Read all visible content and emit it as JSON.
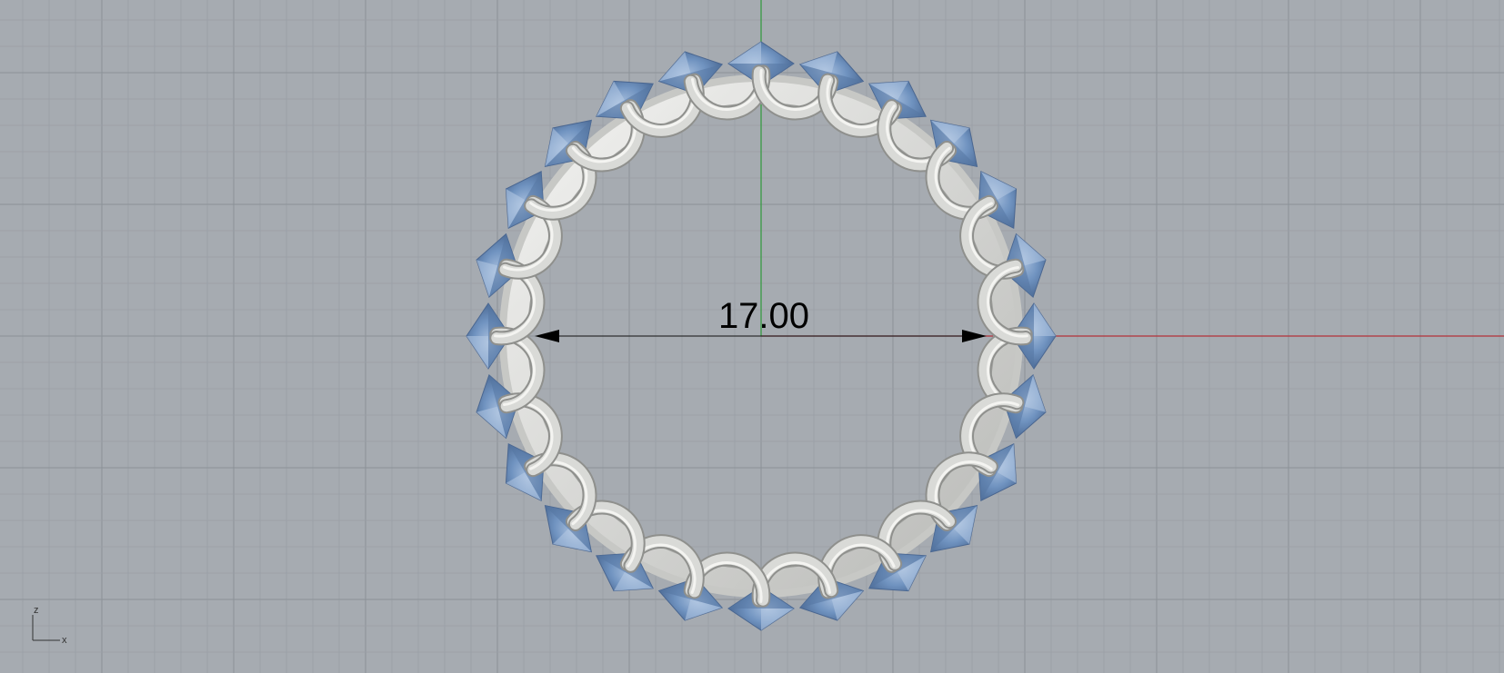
{
  "viewport": {
    "background": "#a6abb1",
    "grid_minor_color": "#9a9fa6",
    "grid_major_color": "#8c9198",
    "x_axis_color": "#b3323a",
    "y_axis_color": "#2f9a3a"
  },
  "ring": {
    "metal_color": "#d9dad7",
    "stone_color": "#6f90bd",
    "stone_count": 24
  },
  "dimension": {
    "value": "17.00"
  },
  "axis_indicator": {
    "vertical_label": "z",
    "horizontal_label": "x"
  }
}
